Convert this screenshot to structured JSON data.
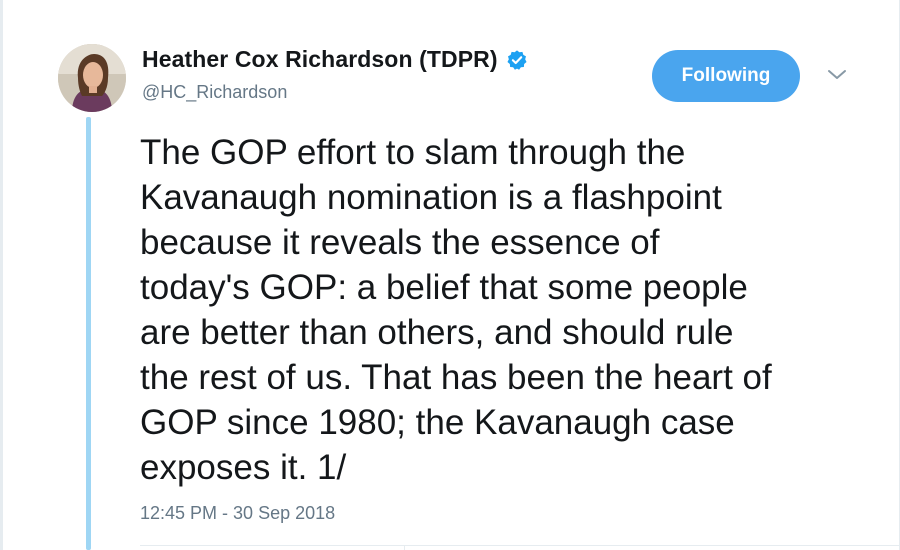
{
  "author": {
    "display_name": "Heather Cox Richardson (TDPR)",
    "handle": "@HC_Richardson",
    "verified": true,
    "avatar_icon": "profile-photo"
  },
  "actions": {
    "follow_label": "Following",
    "more_icon": "chevron-down-icon"
  },
  "tweet": {
    "lines": [
      "The GOP effort to slam through the",
      "Kavanaugh nomination is a flashpoint",
      "because it reveals the essence of",
      "today's GOP: a belief that some people",
      "are better than others, and should rule",
      "the rest of us. That has been the heart of",
      "GOP since 1980; the Kavanaugh case",
      "exposes it. 1/"
    ],
    "timestamp": "12:45 PM - 30 Sep 2018"
  },
  "colors": {
    "accent": "#4aa5ee",
    "thread_line": "#9fd6f4",
    "text": "#14171a",
    "secondary_text": "#657786",
    "verified": "#1da1f2"
  }
}
